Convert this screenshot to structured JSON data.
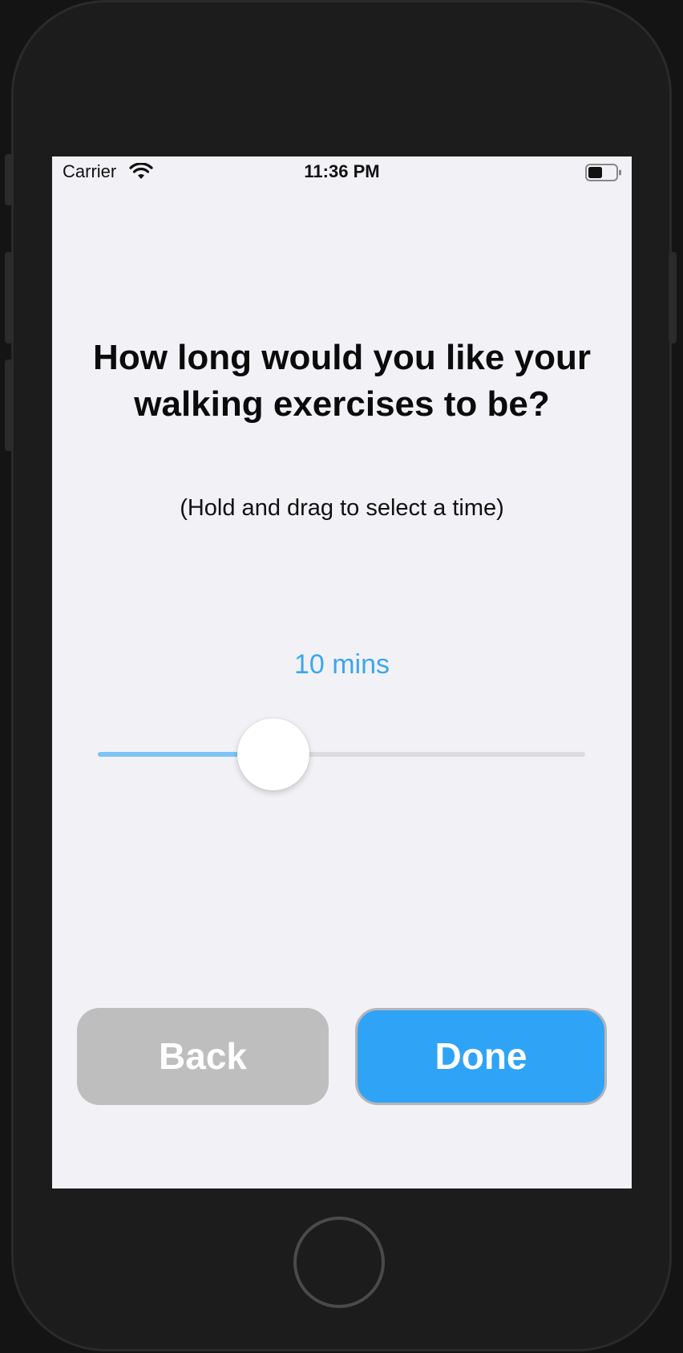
{
  "statusbar": {
    "carrier": "Carrier",
    "time": "11:36 PM",
    "wifi_icon": "wifi-icon",
    "battery_icon": "battery-icon"
  },
  "content": {
    "question": "How long would you like your walking exercises to be?",
    "hint": "(Hold and drag to select a time)",
    "value_label": "10 mins",
    "slider_fraction": 0.36
  },
  "buttons": {
    "back_label": "Back",
    "done_label": "Done"
  },
  "colors": {
    "accent": "#2fa4f6",
    "value_text": "#3ba7ee",
    "track_fill": "#7cc4f5",
    "back_button": "#bebebe",
    "screen_bg": "#f2f2f6"
  }
}
